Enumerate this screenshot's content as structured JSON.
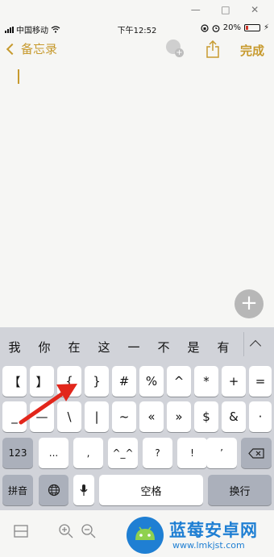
{
  "window_controls": [
    "—",
    "□",
    "✕"
  ],
  "status_bar": {
    "carrier": "中国移动",
    "time": "下午12:52",
    "battery": "20%",
    "battery_level": 0.2
  },
  "nav": {
    "back_label": "备忘录",
    "done_label": "完成"
  },
  "fab_label": "+",
  "keyboard": {
    "candidates": [
      "我",
      "你",
      "在",
      "这",
      "一",
      "不",
      "是",
      "有"
    ],
    "row1": [
      "【",
      "】",
      "{",
      "}",
      "#",
      "%",
      "^",
      "*",
      "+",
      "="
    ],
    "row2": [
      "_",
      "—",
      "\\",
      "|",
      "~",
      "«",
      "»",
      "$",
      "&",
      "·"
    ],
    "row3_mode": "123",
    "row3": [
      "...",
      ",",
      "^_^",
      "?",
      "!",
      "’"
    ],
    "pinyin_label": "拼音",
    "space_label": "空格",
    "return_label": "换行"
  },
  "watermark": {
    "title": "蓝莓安卓网",
    "url": "www.lmkjst.com"
  },
  "colors": {
    "accent": "#c79a2e",
    "arrow": "#e2261b",
    "keyboard_bg": "#d1d3d9",
    "watermark": "#1f7fd3"
  }
}
